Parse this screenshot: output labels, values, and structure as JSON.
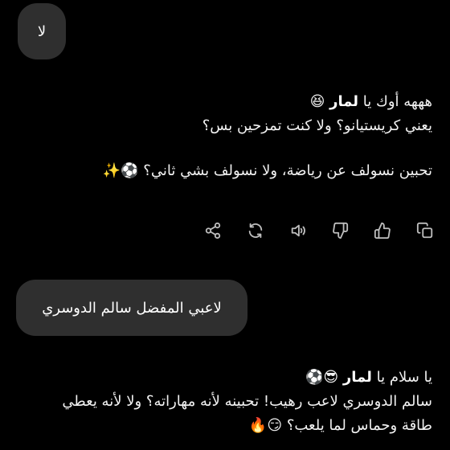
{
  "chat": {
    "user_message_1": "لا",
    "assistant_reply_1": {
      "line1_prefix": "هههه أوك يا ",
      "line1_name": "لمار",
      "line1_emoji": " 😆",
      "line2": "يعني كريستيانو؟ ولا كنت تمزحين بس؟",
      "line3": "تحبين نسولف عن رياضة، ولا نسولف بشي ثاني؟ ⚽✨"
    },
    "user_message_2": "لاعبي المفضل سالم الدوسري",
    "assistant_reply_2": {
      "line1_prefix": "يا سلام يا ",
      "line1_name": "لمار",
      "line1_emoji": " 😎⚽",
      "line2": "سالم الدوسري لاعب رهيب! تحبينه لأنه مهاراته؟ ولا لأنه يعطي",
      "line3": "طاقة وحماس لما يلعب؟ 😏🔥"
    }
  },
  "actions": {
    "icons": [
      "copy-icon",
      "thumbs-up-icon",
      "thumbs-down-icon",
      "speaker-icon",
      "regenerate-icon",
      "share-icon"
    ]
  },
  "colors": {
    "background": "#000000",
    "bubble": "#2f2f2f",
    "text": "#ffffff",
    "icon": "#bdbdbd"
  }
}
